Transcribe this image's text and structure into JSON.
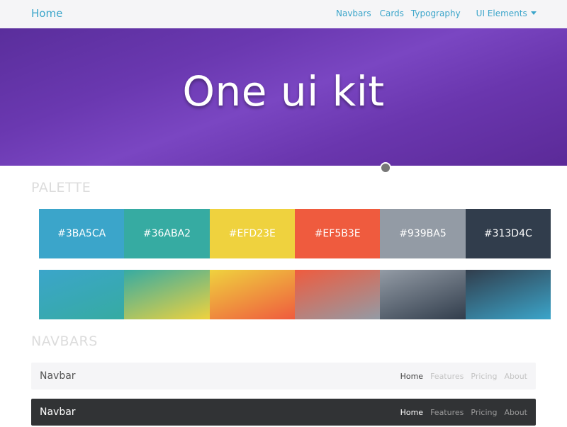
{
  "topnav": {
    "brand": "Home",
    "links": [
      "Navbars",
      "Cards",
      "Typography"
    ],
    "dropdown": "UI Elements"
  },
  "hero": {
    "title": "One ui kit"
  },
  "palette": {
    "title": "PALETTE",
    "colors": [
      {
        "hex": "#3BA5CA",
        "color": "#3ba5ca"
      },
      {
        "hex": "#36ABA2",
        "color": "#36aba2"
      },
      {
        "hex": "#EFD23E",
        "color": "#efd23e"
      },
      {
        "hex": "#EF5B3E",
        "color": "#ef5b3e"
      },
      {
        "hex": "#939BA5",
        "color": "#939ba5"
      },
      {
        "hex": "#313D4C",
        "color": "#313d4c"
      }
    ],
    "gradients": [
      {
        "from": "#3ba5ca",
        "to": "#36aba2"
      },
      {
        "from": "#36aba2",
        "to": "#efd23e"
      },
      {
        "from": "#efd23e",
        "to": "#ef5b3e"
      },
      {
        "from": "#ef5b3e",
        "to": "#939ba5"
      },
      {
        "from": "#939ba5",
        "to": "#313d4c"
      },
      {
        "from": "#313d4c",
        "to": "#3ba5ca"
      }
    ]
  },
  "navbars": {
    "title": "NAVBARS",
    "light": {
      "brand": "Navbar",
      "links": [
        "Home",
        "Features",
        "Pricing",
        "About"
      ]
    },
    "dark": {
      "brand": "Navbar",
      "links": [
        "Home",
        "Features",
        "Pricing",
        "About"
      ]
    }
  }
}
